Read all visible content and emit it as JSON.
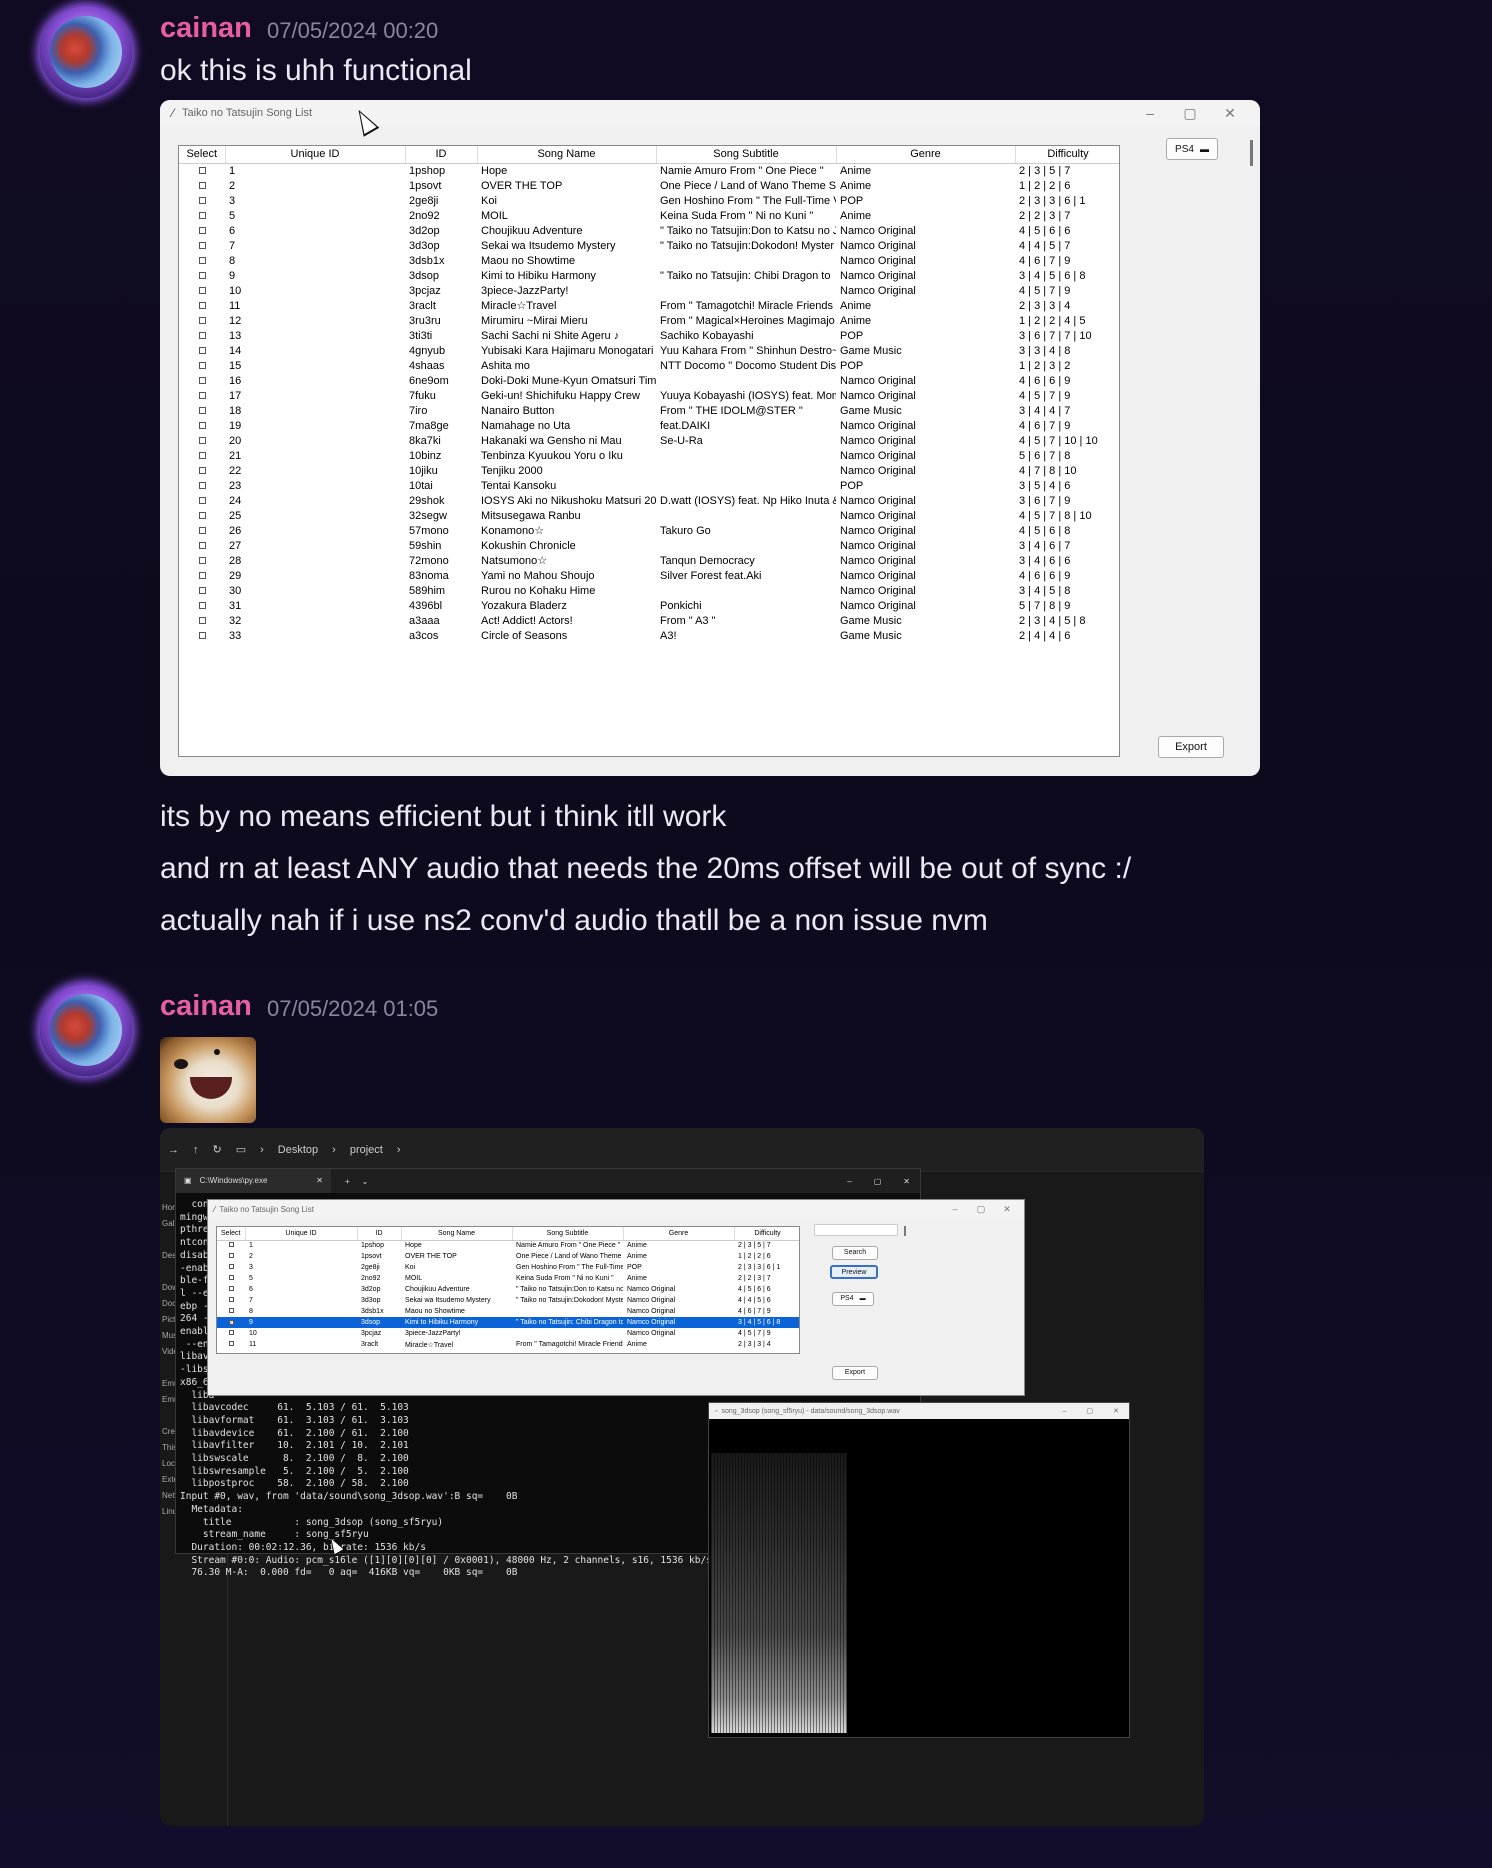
{
  "messages": [
    {
      "username": "cainan",
      "timestamp": "07/05/2024 00:20",
      "text": "ok this is uhh functional"
    },
    {
      "username": "cainan",
      "timestamp": "07/05/2024 01:05"
    }
  ],
  "followups": [
    "its by no means efficient but i think itll work",
    "and rn at least ANY audio that needs the 20ms offset will be out of sync :/",
    "actually nah if i use ns2 conv'd audio thatll be a non issue nvm"
  ],
  "window1": {
    "title": "Taiko no Tatsujin Song List",
    "columns": [
      "Select",
      "Unique ID",
      "ID",
      "Song Name",
      "Song Subtitle",
      "Genre",
      "Difficulty"
    ],
    "platform": "PS4",
    "export_label": "Export",
    "rows": [
      [
        "1",
        "1pshop",
        "Hope",
        "Namie Amuro From \" One Piece \"",
        "Anime",
        "2 | 3 | 5 | 7"
      ],
      [
        "2",
        "1psovt",
        "OVER THE TOP",
        "One Piece / Land of Wano Theme So",
        "Anime",
        "1 | 2 | 2 | 6"
      ],
      [
        "3",
        "2ge8ji",
        "Koi",
        "Gen Hoshino From \" The Full-Time V",
        "POP",
        "2 | 3 | 3 | 6 | 1"
      ],
      [
        "5",
        "2no92",
        "MOIL",
        "Keina Suda From \" Ni no Kuni \"",
        "Anime",
        "2 | 2 | 3 | 7"
      ],
      [
        "6",
        "3d2op",
        "Choujikuu Adventure",
        "\" Taiko no Tatsujin:Don to Katsu no J",
        "Namco Original",
        "4 | 5 | 6 | 6"
      ],
      [
        "7",
        "3d3op",
        "Sekai wa Itsudemo Mystery",
        "\" Taiko no Tatsujin:Dokodon! Myster",
        "Namco Original",
        "4 | 4 | 5 | 7"
      ],
      [
        "8",
        "3dsb1x",
        "Maou no Showtime",
        "",
        "Namco Original",
        "4 | 6 | 7 | 9"
      ],
      [
        "9",
        "3dsop",
        "Kimi to Hibiku Harmony",
        "\" Taiko no Tatsujin: Chibi Dragon to",
        "Namco Original",
        "3 | 4 | 5 | 6 | 8"
      ],
      [
        "10",
        "3pcjaz",
        "3piece-JazzParty!",
        "",
        "Namco Original",
        "4 | 5 | 7 | 9"
      ],
      [
        "11",
        "3raclt",
        "Miracle☆Travel",
        "From \" Tamagotchi! Miracle Friends",
        "Anime",
        "2 | 3 | 3 | 4"
      ],
      [
        "12",
        "3ru3ru",
        "Mirumiru ~Mirai Mieru",
        "From \" Magical×Heroines Magimajo",
        "Anime",
        "1 | 2 | 2 | 4 | 5"
      ],
      [
        "13",
        "3ti3ti",
        "Sachi Sachi ni Shite Ageru ♪",
        "Sachiko Kobayashi",
        "POP",
        "3 | 6 | 7 | 7 | 10"
      ],
      [
        "14",
        "4gnyub",
        "Yubisaki Kara Hajimaru Monogatari",
        "Yuu Kahara From \" Shinhun Destro~",
        "Game Music",
        "3 | 3 | 4 | 8"
      ],
      [
        "15",
        "4shaas",
        "Ashita mo",
        "NTT Docomo \" Docomo Student Dis",
        "POP",
        "1 | 2 | 3 | 2"
      ],
      [
        "16",
        "6ne9om",
        "Doki-Doki Mune-Kyun Omatsuri Tim",
        "",
        "Namco Original",
        "4 | 6 | 6 | 9"
      ],
      [
        "17",
        "7fuku",
        "Geki-un! Shichifuku Happy Crew",
        "Yuuya Kobayashi (IOSYS) feat. Momi",
        "Namco Original",
        "4 | 5 | 7 | 9"
      ],
      [
        "18",
        "7iro",
        "Nanairo Button",
        "From \" THE IDOLM@STER \"",
        "Game Music",
        "3 | 4 | 4 | 7"
      ],
      [
        "19",
        "7ma8ge",
        "Namahage no Uta",
        "feat.DAIKI",
        "Namco Original",
        "4 | 6 | 7 | 9"
      ],
      [
        "20",
        "8ka7ki",
        "Hakanaki wa Gensho ni Mau",
        "Se-U-Ra",
        "Namco Original",
        "4 | 5 | 7 | 10 | 10"
      ],
      [
        "21",
        "10binz",
        "Tenbinza Kyuukou Yoru o Iku",
        "",
        "Namco Original",
        "5 | 6 | 7 | 8"
      ],
      [
        "22",
        "10jiku",
        "Tenjiku 2000",
        "",
        "Namco Original",
        "4 | 7 | 8 | 10"
      ],
      [
        "23",
        "10tai",
        "Tentai Kansoku",
        "",
        "POP",
        "3 | 5 | 4 | 6"
      ],
      [
        "24",
        "29shok",
        "IOSYS Aki no Nikushoku Matsuri 201",
        "D.watt (IOSYS) feat. Np Hiko Inuta &",
        "Namco Original",
        "3 | 6 | 7 | 9"
      ],
      [
        "25",
        "32segw",
        "Mitsusegawa Ranbu",
        "",
        "Namco Original",
        "4 | 5 | 7 | 8 | 10"
      ],
      [
        "26",
        "57mono",
        "Konamono☆",
        "Takuro Go",
        "Namco Original",
        "4 | 5 | 6 | 8"
      ],
      [
        "27",
        "59shin",
        "Kokushin Chronicle",
        "",
        "Namco Original",
        "3 | 4 | 6 | 7"
      ],
      [
        "28",
        "72mono",
        "Natsumono☆",
        "Tanqun Democracy",
        "Namco Original",
        "3 | 4 | 6 | 6"
      ],
      [
        "29",
        "83noma",
        "Yami no Mahou Shoujo",
        "Silver Forest feat.Aki",
        "Namco Original",
        "4 | 6 | 6 | 9"
      ],
      [
        "30",
        "589him",
        "Rurou no Kohaku Hime",
        "",
        "Namco Original",
        "3 | 4 | 5 | 8"
      ],
      [
        "31",
        "4396bl",
        "Yozakura Bladerz",
        "Ponkichi",
        "Namco Original",
        "5 | 7 | 8 | 9"
      ],
      [
        "32",
        "a3aaa",
        "Act! Addict! Actors!",
        "From \" A3 \"",
        "Game Music",
        "2 | 3 | 4 | 5 | 8"
      ],
      [
        "33",
        "a3cos",
        "Circle of Seasons",
        "A3!",
        "Game Music",
        "2 | 4 | 4 | 6"
      ]
    ]
  },
  "screenshot2": {
    "breadcrumb": [
      "Desktop",
      "project"
    ],
    "terminal_tab": "C:\\Windows\\py.exe",
    "terminal_lines": [
      "  conf",
      "mingw3",
      "pthrea",
      "ntconf",
      "disabl",
      "-enabl",
      "ble-fr",
      "l --er",
      "ebp --",
      "264 --",
      "enable",
      " --ena",
      "libavu",
      "-libs=",
      "x86_64",
      "  liba",
      "  libavcodec     61.  5.103 / 61.  5.103",
      "  libavformat    61.  3.103 / 61.  3.103",
      "  libavdevice    61.  2.100 / 61.  2.100",
      "  libavfilter    10.  2.101 / 10.  2.101",
      "  libswscale      8.  2.100 /  8.  2.100",
      "  libswresample   5.  2.100 /  5.  2.100",
      "  libpostproc    58.  2.100 / 58.  2.100",
      "Input #0, wav, from 'data/sound\\song_3dsop.wav':B sq=    0B",
      "  Metadata:",
      "    title           : song_3dsop (song_sf5ryu)",
      "    stream_name     : song_sf5ryu",
      "  Duration: 00:02:12.36, bitrate: 1536 kb/s",
      "  Stream #0:0: Audio: pcm_s16le ([1][0][0][0] / 0x0001), 48000 Hz, 2 channels, s16, 1536 kb/s",
      "  76.30 M-A:  0.000 fd=   0 aq=  416KB vq=    0KB sq=    0B"
    ],
    "left_labels": [
      "Hon",
      "Galle",
      "",
      "Desk",
      "",
      "Dow",
      "Doc",
      "Pict",
      "Mus",
      "Vide",
      "",
      "Emu",
      "Emu",
      "",
      "Crea",
      "This",
      "Loca",
      "Exte",
      "Netw",
      "Linu"
    ],
    "mini_window": {
      "title": "Taiko no Tatsujin Song List",
      "columns": [
        "Select",
        "Unique ID",
        "ID",
        "Song Name",
        "Song Subtitle",
        "Genre",
        "Difficulty"
      ],
      "rows": [
        [
          "1",
          "1pshop",
          "Hope",
          "Namie Amuro From \" One Piece \"",
          "Anime",
          "2 | 3 | 5 | 7"
        ],
        [
          "2",
          "1psovt",
          "OVER THE TOP",
          "One Piece / Land of Wano Theme Se",
          "Anime",
          "1 | 2 | 2 | 6"
        ],
        [
          "3",
          "2ge8ji",
          "Koi",
          "Gen Hoshino From \" The Full-Time V",
          "POP",
          "2 | 3 | 3 | 6 | 1"
        ],
        [
          "5",
          "2no92",
          "MOIL",
          "Keina Suda From \" Ni no Kuni \"",
          "Anime",
          "2 | 2 | 3 | 7"
        ],
        [
          "6",
          "3d2op",
          "Choujikuu Adventure",
          "\" Taiko no Tatsujin:Don to Katsu no J",
          "Namco Original",
          "4 | 5 | 6 | 6"
        ],
        [
          "7",
          "3d3op",
          "Sekai wa Itsudemo Mystery",
          "\" Taiko no Tatsujin:Dokodon! Myster",
          "Namco Original",
          "4 | 4 | 5 | 6"
        ],
        [
          "8",
          "3dsb1x",
          "Maou no Showtime",
          "",
          "Namco Original",
          "4 | 6 | 7 | 9"
        ],
        [
          "9",
          "3dsop",
          "Kimi to Hibiku Harmony",
          "\" Taiko no Tatsujin: Chibi Dragon to",
          "Namco Original",
          "3 | 4 | 5 | 6 | 8"
        ],
        [
          "10",
          "3pcjaz",
          "3piece-JazzParty!",
          "",
          "Namco Original",
          "4 | 5 | 7 | 9"
        ],
        [
          "11",
          "3raclt",
          "Miracle☆Travel",
          "From \" Tamagotchi! Miracle Friends",
          "Anime",
          "2 | 3 | 3 | 4"
        ]
      ],
      "selected_row": 7,
      "search_label": "Search",
      "preview_label": "Preview",
      "platform": "PS4",
      "export_label": "Export"
    },
    "audio_window_title": "song_3dsop (song_sf5ryu) - data/sound/song_3dsop.wav"
  }
}
